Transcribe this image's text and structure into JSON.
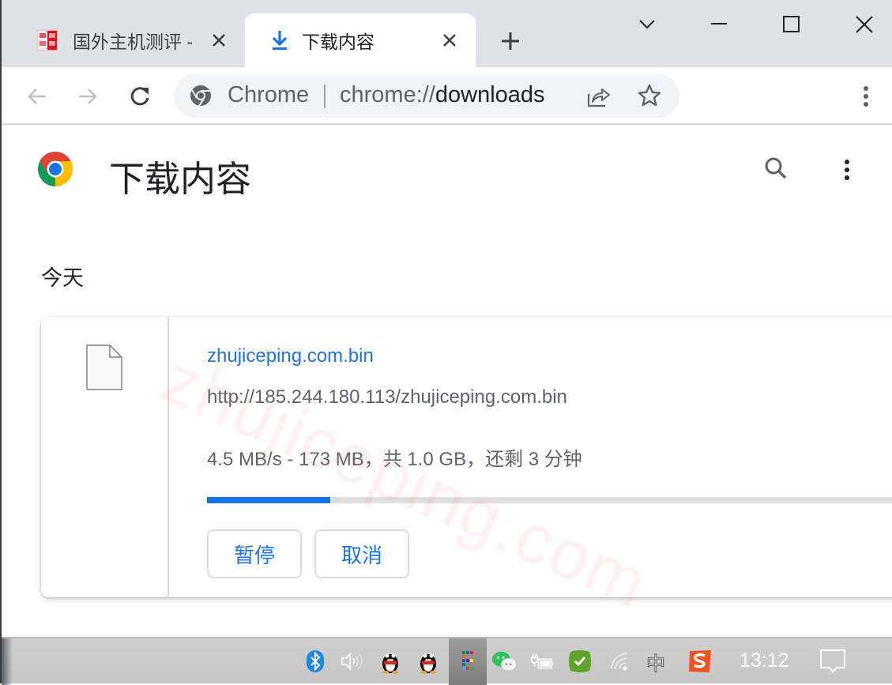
{
  "window": {
    "tabs": [
      {
        "title": "国外主机测评 - ",
        "favicon": "site-favicon",
        "active": false
      },
      {
        "title": "下载内容",
        "favicon": "download-icon",
        "active": true
      }
    ],
    "new_tab_icon": "plus-icon",
    "controls": [
      "chevron-down-icon",
      "minimize-icon",
      "maximize-icon",
      "close-icon"
    ]
  },
  "toolbar": {
    "back": "arrow-left-icon",
    "forward": "arrow-right-icon",
    "reload": "reload-icon",
    "omnibox": {
      "scheme_label": "Chrome",
      "url_prefix": "chrome://",
      "url_host": "downloads"
    },
    "share": "share-icon",
    "bookmark": "star-icon",
    "menu": "more-vert-icon"
  },
  "page": {
    "title": "下载内容",
    "search_icon": "search-icon",
    "menu_icon": "more-vert-icon",
    "section_label": "今天",
    "watermark": "zhujiceping.com",
    "downloads": [
      {
        "file_name": "zhujiceping.com.bin",
        "url": "http://185.244.180.113/zhujiceping.com.bin",
        "status": "4.5 MB/s - 173 MB，共 1.0 GB，还剩 3 分钟",
        "progress": 0.173,
        "buttons": {
          "pause": "暂停",
          "cancel": "取消"
        }
      }
    ]
  },
  "taskbar": {
    "tray_icons": [
      "bluetooth-icon",
      "volume-icon",
      "qq-icon",
      "qq-icon",
      "app-grid-icon",
      "wechat-icon",
      "battery-charging-icon",
      "security-check-icon",
      "wifi-icon",
      "ime-zhong-icon",
      "sogou-ime-icon"
    ],
    "ime_label": "中",
    "clock": "13:12",
    "notification_icon": "notification-icon"
  },
  "colors": {
    "accent": "#1a73e8",
    "tabstrip": "#dee1e6",
    "text_secondary": "#5f6368"
  }
}
